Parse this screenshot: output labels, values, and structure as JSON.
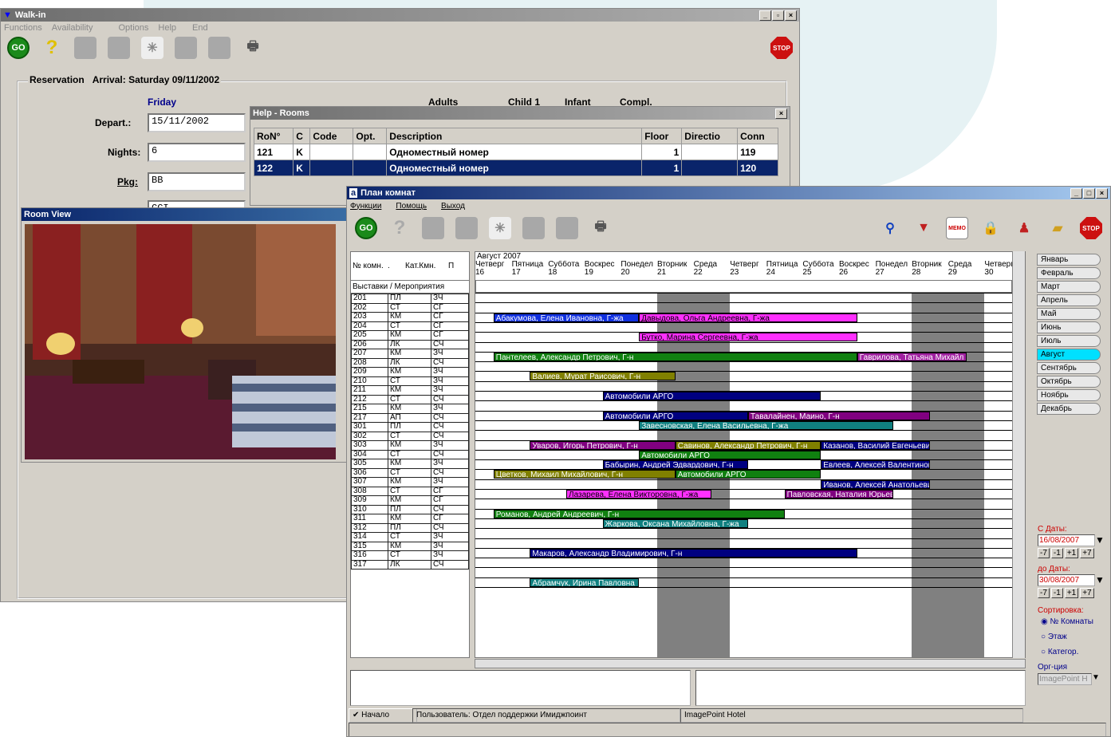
{
  "walkin": {
    "title": "Walk-in",
    "menu": [
      "Functions",
      "Availability",
      "Options",
      "Help",
      "End"
    ],
    "stop_label": "STOP",
    "go_label": "GO",
    "section": "Reservation",
    "arrival": "Arrival: Saturday 09/11/2002",
    "day": "Friday",
    "depart_label": "Depart.:",
    "depart": "15/11/2002",
    "nights_label": "Nights:",
    "nights": "6",
    "pkg_label": "Pkg:",
    "pkg": "BB",
    "partial": "CCI",
    "cols": [
      "Adults",
      "Child 1",
      "Infant",
      "Compl."
    ]
  },
  "help_rooms": {
    "title": "Help - Rooms",
    "headers": [
      "RoN°",
      "C",
      "Code",
      "Opt.",
      "Description",
      "Floor",
      "Directio",
      "Conn"
    ],
    "rows": [
      [
        "121",
        "K",
        "",
        "",
        "Одноместный номер",
        "1",
        "",
        "119"
      ],
      [
        "122",
        "K",
        "",
        "",
        "Одноместный номер",
        "1",
        "",
        "120"
      ]
    ]
  },
  "room_view": {
    "title": "Room View"
  },
  "plan": {
    "title": "План комнат",
    "menu": [
      "Функции",
      "Помощь",
      "Выход"
    ],
    "go_label": "GO",
    "stop_label": "STOP",
    "memo": "MEMO",
    "month_label": "Август 2007",
    "col_room": "№ комн.",
    "col_dot": ".",
    "col_cat": "Кат.Кмн.",
    "col_p": "П",
    "exhibitions": "Выставки / Мероприятия",
    "days": [
      {
        "name": "Четверг",
        "num": "16"
      },
      {
        "name": "Пятница",
        "num": "17"
      },
      {
        "name": "Суббота",
        "num": "18"
      },
      {
        "name": "Воскрес",
        "num": "19"
      },
      {
        "name": "Понедел",
        "num": "20"
      },
      {
        "name": "Вторник",
        "num": "21"
      },
      {
        "name": "Среда",
        "num": "22"
      },
      {
        "name": "Четверг",
        "num": "23"
      },
      {
        "name": "Пятница",
        "num": "24"
      },
      {
        "name": "Суббота",
        "num": "25"
      },
      {
        "name": "Воскрес",
        "num": "26"
      },
      {
        "name": "Понедел",
        "num": "27"
      },
      {
        "name": "Вторник",
        "num": "28"
      },
      {
        "name": "Среда",
        "num": "29"
      },
      {
        "name": "Четверг",
        "num": "30"
      }
    ],
    "rooms": [
      [
        "201",
        "ПЛ",
        "ЗЧ"
      ],
      [
        "202",
        "СТ",
        "СГ"
      ],
      [
        "203",
        "КМ",
        "СГ"
      ],
      [
        "204",
        "СТ",
        "СГ"
      ],
      [
        "205",
        "КМ",
        "СГ"
      ],
      [
        "206",
        "ЛК",
        "СЧ"
      ],
      [
        "207",
        "КМ",
        "ЗЧ"
      ],
      [
        "208",
        "ЛК",
        "СЧ"
      ],
      [
        "209",
        "КМ",
        "ЗЧ"
      ],
      [
        "210",
        "СТ",
        "ЗЧ"
      ],
      [
        "211",
        "КМ",
        "ЗЧ"
      ],
      [
        "212",
        "СТ",
        "СЧ"
      ],
      [
        "215",
        "КМ",
        "ЗЧ"
      ],
      [
        "217",
        "АП",
        "СЧ"
      ],
      [
        "301",
        "ПЛ",
        "СЧ"
      ],
      [
        "302",
        "СТ",
        "СЧ"
      ],
      [
        "303",
        "КМ",
        "ЗЧ"
      ],
      [
        "304",
        "СТ",
        "СЧ"
      ],
      [
        "305",
        "КМ",
        "ЗЧ"
      ],
      [
        "306",
        "СТ",
        "СЧ"
      ],
      [
        "307",
        "КМ",
        "ЗЧ"
      ],
      [
        "308",
        "СТ",
        "СГ"
      ],
      [
        "309",
        "КМ",
        "СГ"
      ],
      [
        "310",
        "ПЛ",
        "СЧ"
      ],
      [
        "311",
        "КМ",
        "СГ"
      ],
      [
        "312",
        "ПЛ",
        "СЧ"
      ],
      [
        "314",
        "СТ",
        "ЗЧ"
      ],
      [
        "315",
        "КМ",
        "ЗЧ"
      ],
      [
        "316",
        "СТ",
        "ЗЧ"
      ],
      [
        "317",
        "ЛК",
        "СЧ"
      ]
    ],
    "bookings": [
      {
        "row": 2,
        "start": 0.5,
        "len": 4,
        "text": "Абакумова, Елена Ивановна, Г-жа",
        "color": "#1030e0",
        "fg": "#fff"
      },
      {
        "row": 2,
        "start": 4.5,
        "len": 6,
        "text": "Давыдова, Ольга Андреевна, Г-жа",
        "color": "#ff30ff",
        "fg": "#000"
      },
      {
        "row": 4,
        "start": 4.5,
        "len": 6,
        "text": "Бутко, Марина Сергеевна, Г-жа",
        "color": "#ff30ff",
        "fg": "#000"
      },
      {
        "row": 6,
        "start": 0.5,
        "len": 10,
        "text": "Пантелеев, Александр Петрович, Г-н",
        "color": "#108010",
        "fg": "#fff"
      },
      {
        "row": 6,
        "start": 10.5,
        "len": 3,
        "text": "Гаврилова, Татьяна Михайл",
        "color": "#a020a0",
        "fg": "#fff"
      },
      {
        "row": 8,
        "start": 1.5,
        "len": 4,
        "text": "Валиев, Мурат Раисович, Г-н",
        "color": "#808000",
        "fg": "#fff"
      },
      {
        "row": 10,
        "start": 3.5,
        "len": 6,
        "text": "Автомобили АРГО",
        "color": "#000080",
        "fg": "#fff"
      },
      {
        "row": 12,
        "start": 3.5,
        "len": 4,
        "text": "Автомобили АРГО",
        "color": "#000080",
        "fg": "#fff"
      },
      {
        "row": 12,
        "start": 7.5,
        "len": 5,
        "text": "Тавалайнен, Маино, Г-н",
        "color": "#800080",
        "fg": "#fff"
      },
      {
        "row": 13,
        "start": 4.5,
        "len": 7,
        "text": "Завесновская, Елена Васильевна, Г-жа",
        "color": "#108080",
        "fg": "#fff"
      },
      {
        "row": 15,
        "start": 1.5,
        "len": 4,
        "text": "Уваров, Игорь Петрович, Г-н",
        "color": "#800080",
        "fg": "#fff"
      },
      {
        "row": 15,
        "start": 5.5,
        "len": 4,
        "text": "Савинов, Александр Петрович, Г-н",
        "color": "#808000",
        "fg": "#fff"
      },
      {
        "row": 15,
        "start": 9.5,
        "len": 3,
        "text": "Казанов, Василий Евгеньевич",
        "color": "#000080",
        "fg": "#fff"
      },
      {
        "row": 16,
        "start": 4.5,
        "len": 5,
        "text": "Автомобили АРГО",
        "color": "#108010",
        "fg": "#fff"
      },
      {
        "row": 17,
        "start": 3.5,
        "len": 4,
        "text": "Бабырин, Андрей Эдвардович, Г-н",
        "color": "#000080",
        "fg": "#fff"
      },
      {
        "row": 17,
        "start": 9.5,
        "len": 3,
        "text": "Евлеев, Алексей Валентинович",
        "color": "#000080",
        "fg": "#fff"
      },
      {
        "row": 18,
        "start": 0.5,
        "len": 5,
        "text": "Цветков, Михаил Михайлович, Г-н",
        "color": "#808000",
        "fg": "#fff"
      },
      {
        "row": 18,
        "start": 5.5,
        "len": 4,
        "text": "Автомобили АРГО",
        "color": "#108010",
        "fg": "#fff"
      },
      {
        "row": 19,
        "start": 9.5,
        "len": 3,
        "text": "Иванов, Алексей Анатольевич",
        "color": "#000080",
        "fg": "#fff"
      },
      {
        "row": 20,
        "start": 2.5,
        "len": 4,
        "text": "Лазарева, Елена Викторовна, Г-жа",
        "color": "#ff30ff",
        "fg": "#000"
      },
      {
        "row": 20,
        "start": 8.5,
        "len": 3,
        "text": "Павловская, Наталия Юрьевна",
        "color": "#800080",
        "fg": "#fff"
      },
      {
        "row": 22,
        "start": 0.5,
        "len": 8,
        "text": "Романов, Андрей Андреевич, Г-н",
        "color": "#108010",
        "fg": "#fff"
      },
      {
        "row": 23,
        "start": 3.5,
        "len": 4,
        "text": "Жаркова, Оксана Михайловна, Г-жа",
        "color": "#108080",
        "fg": "#fff"
      },
      {
        "row": 26,
        "start": 1.5,
        "len": 9,
        "text": "Макаров, Александр Владимирович, Г-н",
        "color": "#000080",
        "fg": "#fff"
      },
      {
        "row": 29,
        "start": 1.5,
        "len": 3,
        "text": "Абрамчук, Ирина Павловна",
        "color": "#108080",
        "fg": "#fff"
      }
    ],
    "months": [
      "Январь",
      "Февраль",
      "Март",
      "Апрель",
      "Май",
      "Июнь",
      "Июль",
      "Август",
      "Сентябрь",
      "Октябрь",
      "Ноябрь",
      "Декабрь"
    ],
    "active_month": "Август",
    "from_label": "С Даты:",
    "from": "16/08/2007",
    "to_label": "до Даты:",
    "to": "30/08/2007",
    "steps": [
      "-7",
      "-1",
      "+1",
      "+7"
    ],
    "sort_label": "Сортировка:",
    "sort_options": [
      "№ Комнаты",
      "Этаж",
      "Категор."
    ],
    "org_label": "Орг-ция",
    "org_value": "ImagePoint H",
    "start_button": "Начало",
    "user": "Пользователь: Отдел поддержки Имиджпоинт",
    "hotel": "ImagePoint Hotel"
  }
}
